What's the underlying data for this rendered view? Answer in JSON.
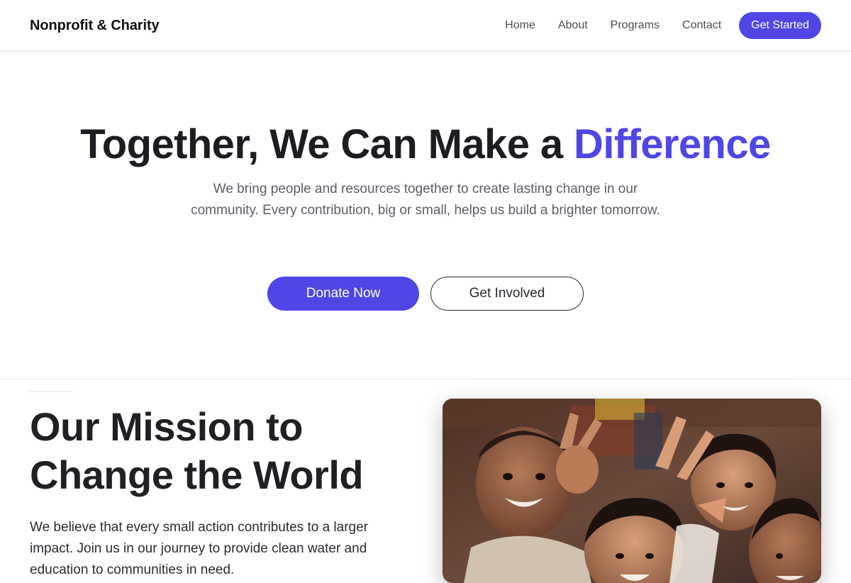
{
  "header": {
    "brand": "Nonprofit & Charity",
    "nav": [
      {
        "label": "Home"
      },
      {
        "label": "About"
      },
      {
        "label": "Programs"
      },
      {
        "label": "Contact"
      }
    ],
    "cta_label": "Get Started"
  },
  "hero": {
    "title_main": "Together, We Can Make a ",
    "title_accent": "Difference",
    "subtitle": "We bring people and resources together to create lasting change in our community. Every contribution, big or small, helps us build a brighter tomorrow.",
    "primary_button": "Donate Now",
    "secondary_button": "Get Involved"
  },
  "mission": {
    "title": "Our Mission to Change the World",
    "text": "We believe that every small action contributes to a larger impact. Join us in our journey to provide clean water and education to communities in need.",
    "image_alt": "Smiling children making peace signs"
  },
  "colors": {
    "accent": "#4f46e5",
    "text_dark": "#1f2024",
    "text_muted": "#5b5e66"
  }
}
